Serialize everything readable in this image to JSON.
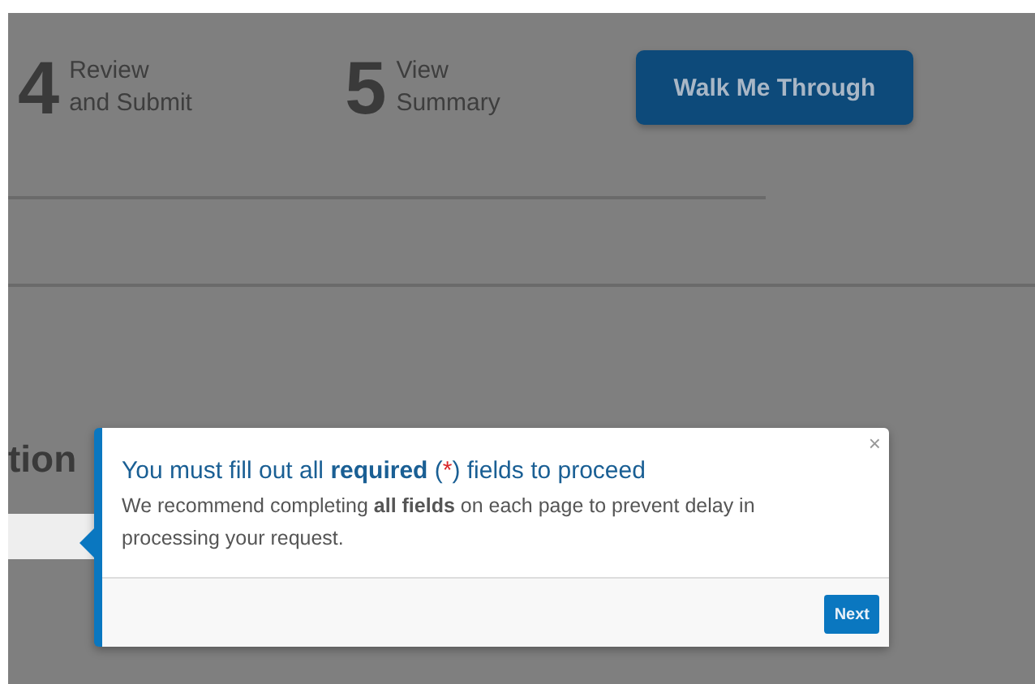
{
  "steps": [
    {
      "number": "4",
      "label": "Review\nand Submit"
    },
    {
      "number": "5",
      "label": "View\nSummary"
    }
  ],
  "walkthrough_button": {
    "label": "Walk Me Through"
  },
  "section_heading": "tion",
  "popup": {
    "close": "×",
    "title_parts": [
      {
        "text": "You must fill out all ",
        "kind": "plain"
      },
      {
        "text": "required",
        "kind": "bold"
      },
      {
        "text": " (",
        "kind": "plain"
      },
      {
        "text": "*",
        "kind": "required-mark"
      },
      {
        "text": ") fields to proceed",
        "kind": "plain"
      }
    ],
    "body": "We recommend completing **all fields** on each page to prevent delay in processing your request.",
    "next_button": "Next"
  }
}
